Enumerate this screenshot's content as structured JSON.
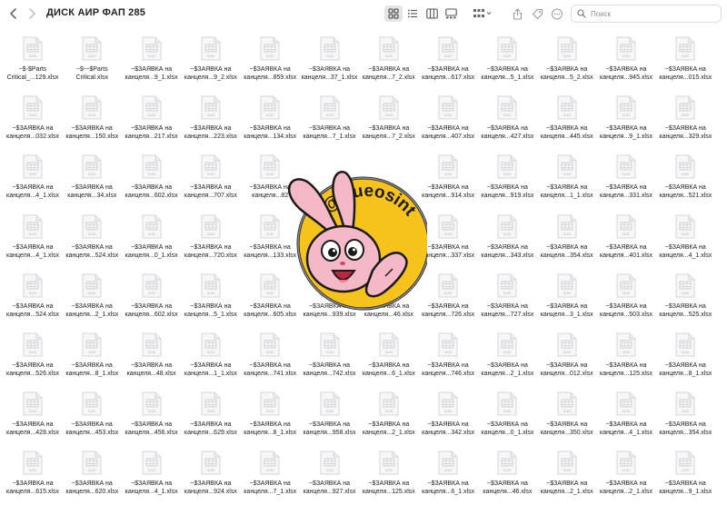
{
  "toolbar": {
    "title": "ДИСК АИР ФАП 285",
    "icons": [
      "chevron-left-icon",
      "chevron-right-icon",
      "grid-view-icon",
      "list-view-icon",
      "column-view-icon",
      "gallery-view-icon",
      "group-by-icon",
      "share-icon",
      "tag-icon",
      "more-icon",
      "search-icon"
    ],
    "search_placeholder": "Поиск"
  },
  "file_icon_label": "XLSX",
  "files": [
    [
      "~$-$Parts",
      "Critical_...129.xlsx"
    ],
    [
      "~$-~$Parts",
      "Critical.xlsx"
    ],
    [
      "~$ЗАЯВКА на",
      "канцеля...9_1.xlsx"
    ],
    [
      "~$ЗАЯВКА на",
      "канцеля...9_2.xlsx"
    ],
    [
      "~$ЗАЯВКА на",
      "канцеля...859.xlsx"
    ],
    [
      "~$ЗАЯВКА на",
      "канцеля...37_1.xlsx"
    ],
    [
      "~$ЗАЯВКА на",
      "канцеля...7_2.xlsx"
    ],
    [
      "~$ЗАЯВКА на",
      "канцеля...617.xlsx"
    ],
    [
      "~$ЗАЯВКА на",
      "канцеля...5_1.xlsx"
    ],
    [
      "~$ЗАЯВКА на",
      "канцеля...5_2.xlsx"
    ],
    [
      "~$ЗАЯВКА на",
      "канцеля...945.xlsx"
    ],
    [
      "~$ЗАЯВКА на",
      "канцеля...015.xlsx"
    ],
    [
      "~$ЗАЯВКА на",
      "канцеля...032.xlsx"
    ],
    [
      "~$ЗАЯВКА на",
      "канцеля...150.xlsx"
    ],
    [
      "~$ЗАЯВКА на",
      "канцеля...217.xlsx"
    ],
    [
      "~$ЗАЯВКА на",
      "канцеля...223.xlsx"
    ],
    [
      "~$ЗАЯВКА на",
      "канцеля...134.xlsx"
    ],
    [
      "~$ЗАЯВКА на",
      "канцеля...7_1.xlsx"
    ],
    [
      "~$ЗАЯВКА на",
      "канцеля...7_2.xlsx"
    ],
    [
      "~$ЗАЯВКА на",
      "канцеля...407.xlsx"
    ],
    [
      "~$ЗАЯВКА на",
      "канцеля...427.xlsx"
    ],
    [
      "~$ЗАЯВКА на",
      "канцеля...445.xlsx"
    ],
    [
      "~$ЗАЯВКА на",
      "канцеля...9_1.xlsx"
    ],
    [
      "~$ЗАЯВКА на",
      "канцеля...329.xlsx"
    ],
    [
      "~$ЗАЯВКА на",
      "канцеля...4_1.xlsx"
    ],
    [
      "~$ЗАЯВКА на",
      "канцеля...34.xlsx"
    ],
    [
      "~$ЗАЯВКА на",
      "канцеля...602.xlsx"
    ],
    [
      "~$ЗАЯВКА на",
      "канцеля...707.xlsx"
    ],
    [
      "~$ЗАЯВКА на",
      "канцеля...82"
    ],
    [
      "",
      ""
    ],
    [
      "",
      ""
    ],
    [
      "~$ЗАЯВКА на",
      "канцеля...914.xlsx"
    ],
    [
      "~$ЗАЯВКА на",
      "канцеля...919.xlsx"
    ],
    [
      "~$ЗАЯВКА на",
      "канцеля...1_1.xlsx"
    ],
    [
      "~$ЗАЯВКА на",
      "канцеля...331.xlsx"
    ],
    [
      "~$ЗАЯВКА на",
      "канцеля...521.xlsx"
    ],
    [
      "~$ЗАЯВКА на",
      "канцеля...4_1.xlsx"
    ],
    [
      "~$ЗАЯВКА на",
      "канцеля...524.xlsx"
    ],
    [
      "~$ЗАЯВКА на",
      "канцеля...0_1.xlsx"
    ],
    [
      "~$ЗАЯВКА на",
      "канцеля...720.xlsx"
    ],
    [
      "~$ЗАЯВКА на",
      "канцеля...133.xlsx"
    ],
    [
      "",
      ""
    ],
    [
      "",
      ""
    ],
    [
      "~$ЗАЯВКА на",
      "канцеля...337.xlsx"
    ],
    [
      "~$ЗАЯВКА на",
      "канцеля...343.xlsx"
    ],
    [
      "~$ЗАЯВКА на",
      "канцеля...354.xlsx"
    ],
    [
      "~$ЗАЯВКА на",
      "канцеля...401.xlsx"
    ],
    [
      "~$ЗАЯВКА на",
      "канцеля...4_1.xlsx"
    ],
    [
      "~$ЗАЯВКА на",
      "канцеля...524.xlsx"
    ],
    [
      "~$ЗАЯВКА на",
      "канцеля...2_1.xlsx"
    ],
    [
      "~$ЗАЯВКА на",
      "канцеля...602.xlsx"
    ],
    [
      "~$ЗАЯВКА на",
      "канцеля...5_1.xlsx"
    ],
    [
      "~$ЗАЯВКА на",
      "канцеля...605.xlsx"
    ],
    [
      "~$ЗАЯВКА на",
      "канцеля...939.xlsx"
    ],
    [
      "~$ЗАЯВКА на",
      "канцеля...46.xlsx"
    ],
    [
      "~$ЗАЯВКА на",
      "канцеля...726.xlsx"
    ],
    [
      "~$ЗАЯВКА на",
      "канцеля...727.xlsx"
    ],
    [
      "~$ЗАЯВКА на",
      "канцеля...3_1.xlsx"
    ],
    [
      "~$ЗАЯВКА на",
      "канцеля...503.xlsx"
    ],
    [
      "~$ЗАЯВКА на",
      "канцеля...525.xlsx"
    ],
    [
      "~$ЗАЯВКА на",
      "канцеля...526.xlsx"
    ],
    [
      "~$ЗАЯВКА на",
      "канцеля...8_1.xlsx"
    ],
    [
      "~$ЗАЯВКА на",
      "канцеля...48.xlsx"
    ],
    [
      "~$ЗАЯВКА на",
      "канцеля...1_1.xlsx"
    ],
    [
      "~$ЗАЯВКА на",
      "канцеля...741.xlsx"
    ],
    [
      "~$ЗАЯВКА на",
      "канцеля...742.xlsx"
    ],
    [
      "~$ЗАЯВКА на",
      "канцеля...6_1.xlsx"
    ],
    [
      "~$ЗАЯВКА на",
      "канцеля...746.xlsx"
    ],
    [
      "~$ЗАЯВКА на",
      "канцеля...2_1.xlsx"
    ],
    [
      "~$ЗАЯВКА на",
      "канцеля...012.xlsx"
    ],
    [
      "~$ЗАЯВКА на",
      "канцеля...125.xlsx"
    ],
    [
      "~$ЗАЯВКА на",
      "канцеля...8_1.xlsx"
    ],
    [
      "~$ЗАЯВКА на",
      "канцеля...428.xlsx"
    ],
    [
      "~$ЗАЯВКА на",
      "канцеля...453.xlsx"
    ],
    [
      "~$ЗАЯВКА на",
      "канцеля...456.xlsx"
    ],
    [
      "~$ЗАЯВКА на",
      "канцеля...629.xlsx"
    ],
    [
      "~$ЗАЯВКА на",
      "канцеля...8_1.xlsx"
    ],
    [
      "~$ЗАЯВКА на",
      "канцеля...958.xlsx"
    ],
    [
      "~$ЗАЯВКА на",
      "канцеля...2_1.xlsx"
    ],
    [
      "~$ЗАЯВКА на",
      "канцеля...342.xlsx"
    ],
    [
      "~$ЗАЯВКА на",
      "канцеля...0_1.xlsx"
    ],
    [
      "~$ЗАЯВКА на",
      "канцеля...350.xlsx"
    ],
    [
      "~$ЗАЯВКА на",
      "канцеля...4_1.xlsx"
    ],
    [
      "~$ЗАЯВКА на",
      "канцеля...354.xlsx"
    ],
    [
      "~$ЗАЯВКА на",
      "канцеля...615.xlsx"
    ],
    [
      "~$ЗАЯВКА на",
      "канцеля...620.xlsx"
    ],
    [
      "~$ЗАЯВКА на",
      "канцеля...4_1.xlsx"
    ],
    [
      "~$ЗАЯВКА на",
      "канцеля...924.xlsx"
    ],
    [
      "~$ЗАЯВКА на",
      "канцеля...7_1.xlsx"
    ],
    [
      "~$ЗАЯВКА на",
      "канцеля...927.xlsx"
    ],
    [
      "~$ЗАЯВКА на",
      "канцеля...125.xlsx"
    ],
    [
      "~$ЗАЯВКА на",
      "канцеля...6_1.xlsx"
    ],
    [
      "~$ЗАЯВКА на",
      "канцеля...46.xlsx"
    ],
    [
      "~$ЗАЯВКА на",
      "канцеля...2_1.xlsx"
    ],
    [
      "~$ЗАЯВКА на",
      "канцеля...2_1.xlsx"
    ],
    [
      "~$ЗАЯВКА на",
      "канцеля...9_1.xlsx"
    ]
  ],
  "sticker": {
    "text": "@trueosint",
    "icon": "bunny-sticker-icon"
  },
  "colors": {
    "sticker_yellow": "#f6c21c",
    "sticker_dark": "#1a1a1a",
    "bunny_pink": "#f5b8c7",
    "bunny_white": "#ffffff"
  }
}
